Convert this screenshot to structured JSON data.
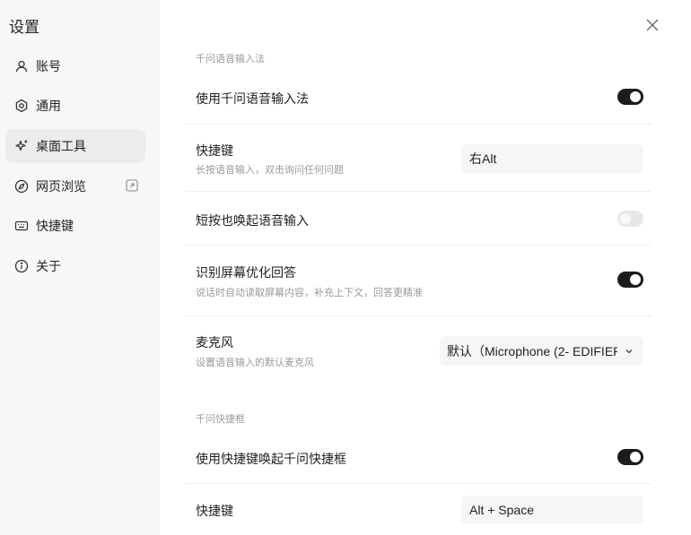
{
  "sidebar": {
    "title": "设置",
    "items": [
      {
        "label": "账号",
        "icon": "user-icon"
      },
      {
        "label": "通用",
        "icon": "hexagon-settings-icon"
      },
      {
        "label": "桌面工具",
        "icon": "sparkle-icon",
        "active": true
      },
      {
        "label": "网页浏览",
        "icon": "compass-icon",
        "external": true
      },
      {
        "label": "快捷键",
        "icon": "keyboard-icon"
      },
      {
        "label": "关于",
        "icon": "info-icon"
      }
    ]
  },
  "voice_section": {
    "title": "千问语音输入法",
    "enable_voice": {
      "label": "使用千问语音输入法",
      "enabled": true
    },
    "shortcut": {
      "label": "快捷键",
      "desc": "长按语音输入，双击询问任何问题",
      "value": "右Alt"
    },
    "short_press": {
      "label": "短按也唤起语音输入",
      "enabled": false
    },
    "screen_recognition": {
      "label": "识别屏幕优化回答",
      "desc": "说话时自动读取屏幕内容，补充上下文，回答更精准",
      "enabled": true
    },
    "microphone": {
      "label": "麦克风",
      "desc": "设置语音输入的默认麦克风",
      "value": "默认（Microphone (2- EDIFIER..."
    }
  },
  "quickbox_section": {
    "title": "千问快捷框",
    "enable_quickbox": {
      "label": "使用快捷键唤起千问快捷框",
      "enabled": true
    },
    "shortcut": {
      "label": "快捷键",
      "value": "Alt + Space"
    }
  },
  "colors": {
    "toggle_on": "#1c1c1c",
    "toggle_off": "#e7e7e7",
    "sidebar_bg": "#f7f7f8",
    "active_item_bg": "#ececee"
  }
}
